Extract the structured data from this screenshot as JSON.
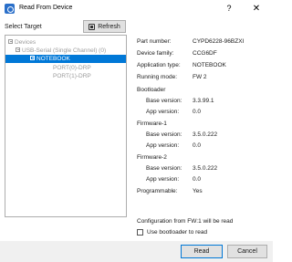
{
  "window": {
    "title": "Read From Device",
    "help_glyph": "?",
    "close_glyph": "✕",
    "icon": "app-icon"
  },
  "left": {
    "select_label": "Select Target",
    "refresh_label": "Refresh",
    "tree": [
      {
        "label": "Devices",
        "expanded": true
      },
      {
        "label": "USB-Serial (Single Channel) (0)",
        "expanded": true
      },
      {
        "label": "NOTEBOOK",
        "expanded": true,
        "selected": true
      },
      {
        "label": "PORT(0)-DRP"
      },
      {
        "label": "PORT(1)-DRP"
      }
    ]
  },
  "info": {
    "part_number": {
      "label": "Part number:",
      "value": "CYPD6228-96BZXI"
    },
    "device_family": {
      "label": "Device family:",
      "value": "CCG6DF"
    },
    "application_type": {
      "label": "Application type:",
      "value": "NOTEBOOK"
    },
    "running_mode": {
      "label": "Running mode:",
      "value": "FW 2"
    },
    "bootloader": {
      "heading": "Bootloader",
      "base_label": "Base version:",
      "base_value": "3.3.99.1",
      "app_label": "App version:",
      "app_value": "0.0"
    },
    "firmware1": {
      "heading": "Firmware-1",
      "base_label": "Base version:",
      "base_value": "3.5.0.222",
      "app_label": "App version:",
      "app_value": "0.0"
    },
    "firmware2": {
      "heading": "Firmware-2",
      "base_label": "Base version:",
      "base_value": "3.5.0.222",
      "app_label": "App version:",
      "app_value": "0.0"
    },
    "programmable": {
      "label": "Programmable:",
      "value": "Yes"
    },
    "note": "Configuration from FW:1 will be read",
    "checkbox_label": "Use bootloader to read",
    "checkbox_checked": false
  },
  "buttons": {
    "read": "Read",
    "cancel": "Cancel"
  },
  "colors": {
    "selection": "#0078d7",
    "disabled_text": "#9a9a9a"
  }
}
